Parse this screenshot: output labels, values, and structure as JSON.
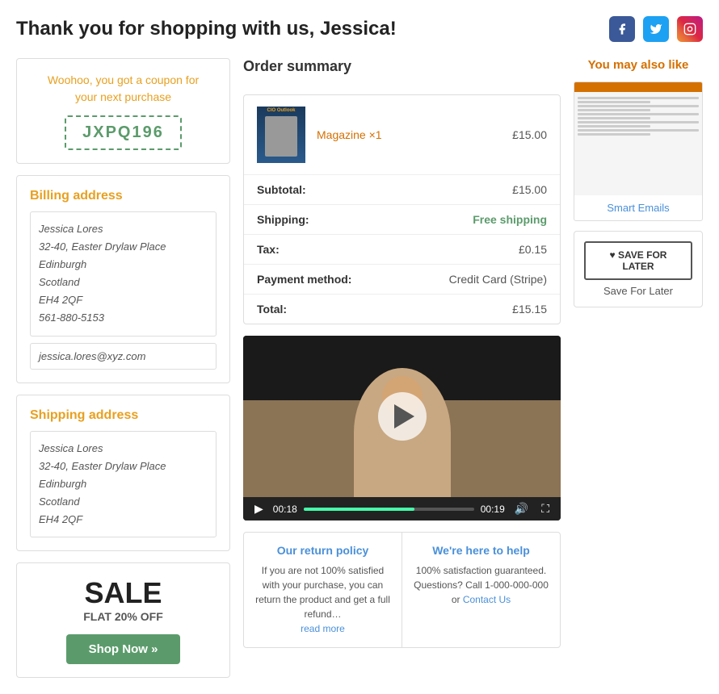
{
  "header": {
    "title": "Thank you for shopping with us, Jessica!",
    "social": {
      "facebook_label": "f",
      "twitter_label": "t",
      "instagram_label": "ig"
    }
  },
  "coupon": {
    "text_line1": "Woohoo, you got a coupon for",
    "text_line2": "your next purchase",
    "code": "JXPQ196"
  },
  "billing": {
    "title": "Billing address",
    "name": "Jessica Lores",
    "address1": "32-40, Easter Drylaw Place",
    "city": "Edinburgh",
    "region": "Scotland",
    "postcode": "EH4 2QF",
    "phone": "561-880-5153",
    "email": "jessica.lores@xyz.com"
  },
  "shipping": {
    "title": "Shipping address",
    "name": "Jessica Lores",
    "address1": "32-40, Easter Drylaw Place",
    "city": "Edinburgh",
    "region": "Scotland",
    "postcode": "EH4 2QF"
  },
  "sale": {
    "title": "SALE",
    "subtitle": "FLAT 20% OFF",
    "button": "Shop Now »"
  },
  "order_summary": {
    "title": "Order summary",
    "product_name": "Magazine ×1",
    "product_price": "£15.00",
    "rows": [
      {
        "label": "Subtotal:",
        "value": "£15.00",
        "type": "normal"
      },
      {
        "label": "Shipping:",
        "value": "Free shipping",
        "type": "free"
      },
      {
        "label": "Tax:",
        "value": "£0.15",
        "type": "normal"
      },
      {
        "label": "Payment method:",
        "value": "Credit Card (Stripe)",
        "type": "normal"
      },
      {
        "label": "Total:",
        "value": "£15.15",
        "type": "normal"
      }
    ]
  },
  "video": {
    "time_current": "00:18",
    "time_total": "00:19",
    "progress_percent": 65
  },
  "return_policy": {
    "title": "Our return policy",
    "text": "If you are not 100% satisfied with your purchase, you can return the product and get a full refund…",
    "link": "read more"
  },
  "help": {
    "title": "We're here to help",
    "text": "100% satisfaction guaranteed. Questions? Call 1-000-000-000 or",
    "link": "Contact Us"
  },
  "sidebar_right": {
    "title": "You may also like",
    "product_label": "Smart Emails",
    "save_button": "♥ SAVE FOR LATER",
    "save_label": "Save For Later"
  }
}
